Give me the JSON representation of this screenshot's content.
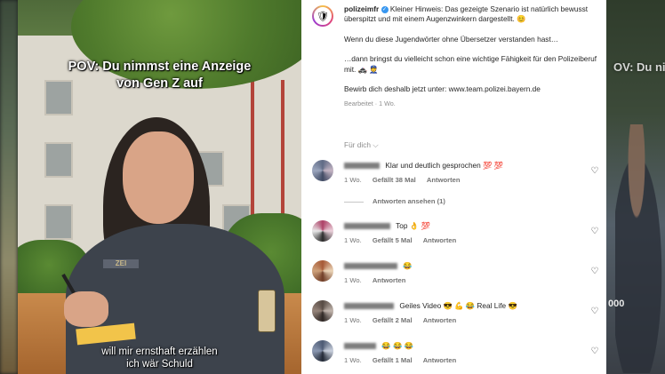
{
  "video": {
    "caption_line1": "POV: Du nimmst eine Anzeige",
    "caption_line2": "von Gen Z auf",
    "subtitle_line1": "will mir ernsthaft erzählen",
    "subtitle_line2": "ich wär Schuld",
    "badge_text": "ZEI"
  },
  "background_right": {
    "caption": "OV: Du nimmst eine",
    "number": "000"
  },
  "post": {
    "username": "polizeimfr",
    "verified_icon": "✓",
    "caption_p1": "Kleiner Hinweis: Das gezeigte Szenario ist natürlich bewusst überspitzt und mit einem Augenzwinkern dargestellt. 😊",
    "caption_p2": "Wenn du diese Jugendwörter ohne Übersetzer verstanden hast…",
    "caption_p3": "…dann bringst du vielleicht schon eine wichtige Fähigkeit für den Polizeiberuf mit. 🚓 👮",
    "caption_p4": "Bewirb dich deshalb jetzt unter: www.team.polizei.bayern.de",
    "meta": "Bearbeitet · 1 Wo.",
    "translate": "Für dich ⌵"
  },
  "comments": [
    {
      "text": "Klar und deutlich gesprochen 💯 💯",
      "time": "1 Wo.",
      "likes": "Gefällt 38 Mal",
      "reply": "Antworten"
    },
    {
      "text": "Top 👌 💯",
      "time": "1 Wo.",
      "likes": "Gefällt 5 Mal",
      "reply": "Antworten"
    },
    {
      "text": "😂",
      "time": "1 Wo.",
      "likes": "",
      "reply": "Antworten"
    },
    {
      "text": "Geiles Video 😎 💪 😂 Real Life 😎",
      "time": "1 Wo.",
      "likes": "Gefällt 2 Mal",
      "reply": "Antworten"
    },
    {
      "text": "😂 😂 😂",
      "time": "1 Wo.",
      "likes": "Gefällt 1 Mal",
      "reply": "Antworten"
    }
  ],
  "replies_label": "Antworten ansehen (1)",
  "icons": {
    "heart": "♡",
    "avatar_main": "🛡"
  }
}
